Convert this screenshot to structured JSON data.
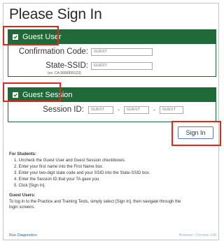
{
  "page": {
    "title": "Please Sign In"
  },
  "guest_user": {
    "header": "Guest User",
    "confirmation_label": "Confirmation Code:",
    "confirmation_placeholder": "GUEST",
    "ssid_label": "State-SSID:",
    "ssid_placeholder": "GUEST",
    "ssid_hint": "(ex: CA-9999999123)"
  },
  "guest_session": {
    "header": "Guest Session",
    "session_label": "Session ID:",
    "parts": [
      "GUEST",
      "GUEST",
      "GUEST"
    ],
    "separator": "-"
  },
  "signin_label": "Sign In",
  "instructions": {
    "students_heading": "For Students:",
    "steps": [
      "1.  Uncheck the Guest User and Guest Session checkboxes.",
      "2.  Enter your first name into the First Name box.",
      "3.  Enter your two-digit state code and your SSID into the State-SSID box.",
      "4.  Enter the Session ID that your TA gave you.",
      "5.  Click [Sign In]."
    ],
    "guest_heading": "Guest Users:",
    "guest_text_1": "To log in to the Practice and Training Tests, simply select [Sign In], then navigate through the",
    "guest_text_2": "login screens."
  },
  "footer": {
    "diagnostics": "Run Diagnostics",
    "browser": "Browser: Chrome v38"
  },
  "colors": {
    "header_green": "#1f6a38",
    "highlight_red": "#e3271d",
    "link_blue": "#2a5db0"
  }
}
